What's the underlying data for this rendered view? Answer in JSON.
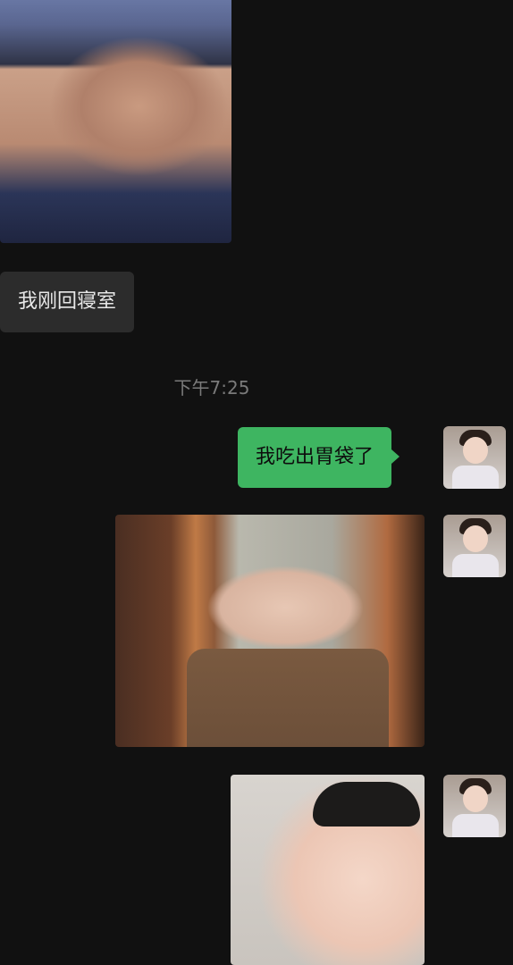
{
  "messages": {
    "incoming_text": "我刚回寝室",
    "timestamp": "下午7:25",
    "outgoing_text": "我吃出胃袋了"
  },
  "colors": {
    "background": "#111111",
    "incoming_bubble": "#2c2c2c",
    "outgoing_bubble": "#3eb561",
    "timestamp_text": "#7a7a7a"
  },
  "icons": {
    "avatar": "user-avatar-photo"
  }
}
